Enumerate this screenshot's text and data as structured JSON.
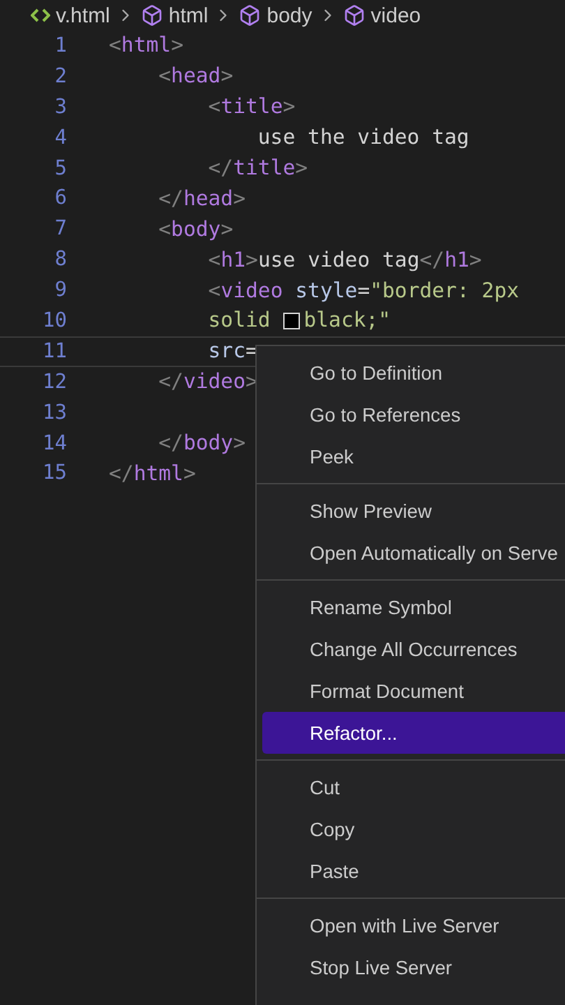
{
  "breadcrumb": [
    {
      "kind": "file",
      "label": "v.html"
    },
    {
      "kind": "element",
      "label": "html"
    },
    {
      "kind": "element",
      "label": "body"
    },
    {
      "kind": "element",
      "label": "video"
    }
  ],
  "editor": {
    "lines": [
      {
        "number": "1",
        "current": false,
        "tokens": [
          {
            "kind": "punct",
            "text": "<"
          },
          {
            "kind": "tag",
            "text": "html"
          },
          {
            "kind": "punct",
            "text": ">"
          }
        ]
      },
      {
        "number": "2",
        "current": false,
        "tokens": [
          {
            "kind": "punct",
            "text": "    <"
          },
          {
            "kind": "tag",
            "text": "head"
          },
          {
            "kind": "punct",
            "text": ">"
          }
        ]
      },
      {
        "number": "3",
        "current": false,
        "tokens": [
          {
            "kind": "punct",
            "text": "        <"
          },
          {
            "kind": "tag",
            "text": "title"
          },
          {
            "kind": "punct",
            "text": ">"
          }
        ]
      },
      {
        "number": "4",
        "current": false,
        "tokens": [
          {
            "kind": "text",
            "text": "            use the video tag"
          }
        ]
      },
      {
        "number": "5",
        "current": false,
        "tokens": [
          {
            "kind": "punct",
            "text": "        </"
          },
          {
            "kind": "tag",
            "text": "title"
          },
          {
            "kind": "punct",
            "text": ">"
          }
        ]
      },
      {
        "number": "6",
        "current": false,
        "tokens": [
          {
            "kind": "punct",
            "text": "    </"
          },
          {
            "kind": "tag",
            "text": "head"
          },
          {
            "kind": "punct",
            "text": ">"
          }
        ]
      },
      {
        "number": "7",
        "current": false,
        "tokens": [
          {
            "kind": "punct",
            "text": "    <"
          },
          {
            "kind": "tag",
            "text": "body"
          },
          {
            "kind": "punct",
            "text": ">"
          }
        ]
      },
      {
        "number": "8",
        "current": false,
        "tokens": [
          {
            "kind": "punct",
            "text": "        <"
          },
          {
            "kind": "tag",
            "text": "h1"
          },
          {
            "kind": "punct",
            "text": ">"
          },
          {
            "kind": "text",
            "text": "use video tag"
          },
          {
            "kind": "punct",
            "text": "</"
          },
          {
            "kind": "tag",
            "text": "h1"
          },
          {
            "kind": "punct",
            "text": ">"
          }
        ]
      },
      {
        "number": "9",
        "current": false,
        "tokens": [
          {
            "kind": "punct",
            "text": "        <"
          },
          {
            "kind": "tag",
            "text": "video"
          },
          {
            "kind": "attr",
            "text": " style"
          },
          {
            "kind": "text",
            "text": "="
          },
          {
            "kind": "string",
            "text": "\"border: 2px"
          }
        ]
      },
      {
        "number": "10",
        "current": false,
        "tokens": [
          {
            "kind": "string",
            "text": "        solid "
          },
          {
            "kind": "swatch",
            "color": "#000000"
          },
          {
            "kind": "string",
            "text": "black;\""
          }
        ]
      },
      {
        "number": "11",
        "current": true,
        "tokens": [
          {
            "kind": "attr",
            "text": "        src"
          },
          {
            "kind": "text",
            "text": "="
          }
        ]
      },
      {
        "number": "12",
        "current": false,
        "tokens": [
          {
            "kind": "punct",
            "text": "    </"
          },
          {
            "kind": "tag",
            "text": "video"
          },
          {
            "kind": "punct",
            "text": ">"
          }
        ]
      },
      {
        "number": "13",
        "current": false
      },
      {
        "number": "14",
        "current": false,
        "tokens": [
          {
            "kind": "punct",
            "text": "    </"
          },
          {
            "kind": "tag",
            "text": "body"
          },
          {
            "kind": "punct",
            "text": ">"
          }
        ]
      },
      {
        "number": "15",
        "current": false,
        "tokens": [
          {
            "kind": "punct",
            "text": "</"
          },
          {
            "kind": "tag",
            "text": "html"
          },
          {
            "kind": "punct",
            "text": ">"
          }
        ]
      }
    ]
  },
  "context_menu": {
    "groups": [
      [
        {
          "label": "Go to Definition",
          "selected": false
        },
        {
          "label": "Go to References",
          "selected": false
        },
        {
          "label": "Peek",
          "selected": false
        }
      ],
      [
        {
          "label": "Show Preview",
          "selected": false
        },
        {
          "label": "Open Automatically on Serve",
          "selected": false
        }
      ],
      [
        {
          "label": "Rename Symbol",
          "selected": false
        },
        {
          "label": "Change All Occurrences",
          "selected": false
        },
        {
          "label": "Format Document",
          "selected": false
        },
        {
          "label": "Refactor...",
          "selected": true
        }
      ],
      [
        {
          "label": "Cut",
          "selected": false
        },
        {
          "label": "Copy",
          "selected": false
        },
        {
          "label": "Paste",
          "selected": false
        }
      ],
      [
        {
          "label": "Open with Live Server",
          "selected": false
        },
        {
          "label": "Stop Live Server",
          "selected": false
        }
      ]
    ]
  }
}
